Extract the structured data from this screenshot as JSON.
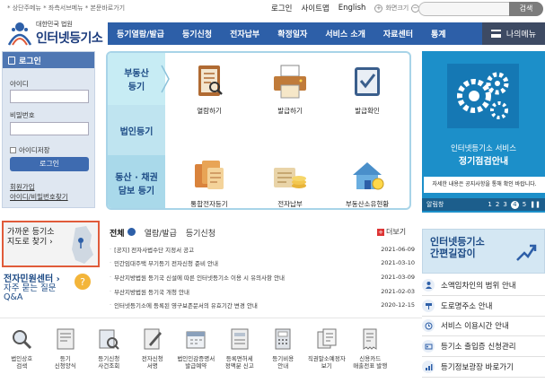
{
  "util": {
    "left_text": "* 상단주메뉴 * 좌측서브메뉴 * 본문바로가기",
    "login": "로그인",
    "sitemap": "사이트맵",
    "english": "English",
    "zoom_label": "화면크기",
    "search_button": "검색"
  },
  "logo": {
    "sub": "대한민국 법원",
    "main": "인터넷등기소"
  },
  "nav": {
    "items": [
      "등기열람/발급",
      "등기신청",
      "전자납부",
      "확정일자",
      "서비스 소개",
      "자료센터",
      "통계"
    ],
    "mymenu": "나의메뉴"
  },
  "login_box": {
    "title": "로그인",
    "id_label": "아이디",
    "pw_label": "비밀번호",
    "save_id": "아이디저장",
    "button": "로그인",
    "signup": "회원가입",
    "find": "아이디/비밀번호찾기"
  },
  "panel": {
    "rows": [
      "부동산\n등기",
      "법인등기",
      "동산 · 채권\n담보 등기"
    ],
    "services": [
      "열람하기",
      "발급하기",
      "발급확인",
      "통합전자등기",
      "전자납부",
      "부동산소유현황"
    ]
  },
  "banner": {
    "line1": "인터넷등기소 서비스",
    "line2": "정기점검안내",
    "notice": "자세한 내용은 공지사항을 통해 확인 바랍니다.",
    "popup_label": "알림창",
    "pages": [
      "1",
      "2",
      "3",
      "4",
      "5"
    ],
    "current_page": "4"
  },
  "nearby": {
    "line1": "가까운 등기소",
    "line2": "지도로 찾기 ›"
  },
  "civil": {
    "title": "전자민원센터 ›",
    "faq1": "자주 묻는 질문",
    "faq2": "Q&A"
  },
  "notice": {
    "tabs": [
      "전체",
      "열람/발급",
      "등기신청"
    ],
    "more": "더보기",
    "items": [
      {
        "text": "[공지] 전자사법수단 지정서 공고",
        "date": "2021-06-09"
      },
      {
        "text": "민간임대주택 부기등기 전자신청 준비 안내",
        "date": "2021-03-10"
      },
      {
        "text": "부산지방법원 등기국 신설에 따른 인터넷등기소 이용 시 유의사항 안내",
        "date": "2021-03-09"
      },
      {
        "text": "부산지방법원 등기국 개청 안내",
        "date": "2021-02-03"
      },
      {
        "text": "인터넷등기소에 등록된 영구보존문서의 유효기간 변경 안내",
        "date": "2020-12-15"
      }
    ]
  },
  "right": {
    "banner_line1": "인터넷등기소",
    "banner_line2": "간편길잡이",
    "links": [
      "소액임차인의 범위 안내",
      "도로명주소 안내",
      "서비스 이용시간 안내",
      "등기소 출입증 신청관리",
      "등기정보광장 바로가기"
    ]
  },
  "bottom": {
    "items": [
      [
        "법인상호",
        "검색"
      ],
      [
        "등기",
        "신청양식"
      ],
      [
        "등기신청",
        "사건조회"
      ],
      [
        "전자신청",
        "서명"
      ],
      [
        "법인인감증명서",
        "발급예약"
      ],
      [
        "등록면허세",
        "정액분 신고"
      ],
      [
        "등기비용",
        "안내"
      ],
      [
        "직권말소예정자",
        "보기"
      ],
      [
        "신용카드",
        "매출전표 발행"
      ]
    ]
  }
}
